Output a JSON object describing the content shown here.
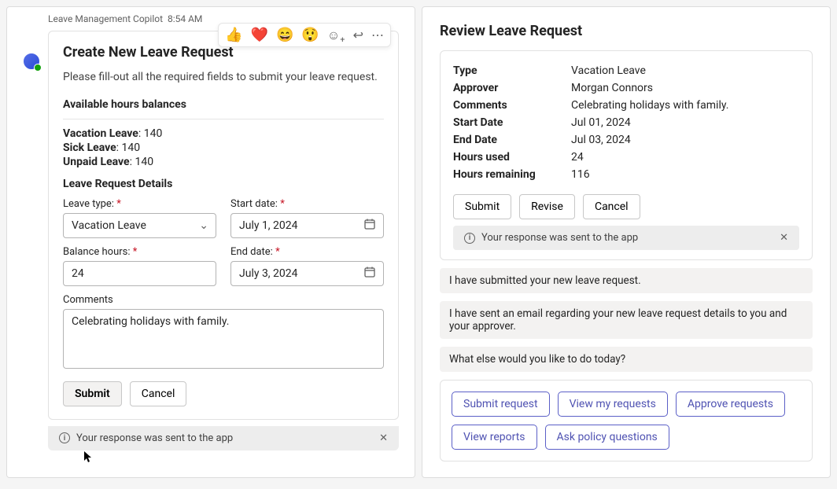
{
  "left": {
    "header": {
      "name": "Leave Management Copilot",
      "time": "8:54 AM"
    },
    "reactions": [
      "👍",
      "❤️",
      "😄",
      "😲"
    ],
    "card": {
      "title": "Create New Leave Request",
      "desc": "Please fill-out all the required fields to submit your leave request.",
      "balances_heading": "Available hours balances",
      "balances": [
        {
          "label": "Vacation Leave",
          "value": "140"
        },
        {
          "label": "Sick Leave",
          "value": "140"
        },
        {
          "label": "Unpaid Leave",
          "value": "140"
        }
      ],
      "details_heading": "Leave Request Details",
      "labels": {
        "leave_type": "Leave type:",
        "start_date": "Start date:",
        "balance_hours": "Balance hours:",
        "end_date": "End date:",
        "comments": "Comments"
      },
      "values": {
        "leave_type": "Vacation Leave",
        "start_date": "July 1, 2024",
        "balance_hours": "24",
        "end_date": "July 3, 2024",
        "comments": "Celebrating holidays with family."
      },
      "buttons": {
        "submit": "Submit",
        "cancel": "Cancel"
      },
      "status": "Your response was sent to the app"
    }
  },
  "right": {
    "title": "Review Leave Request",
    "rows": {
      "type_k": "Type",
      "type_v": "Vacation Leave",
      "approver_k": "Approver",
      "approver_v": "Morgan Connors",
      "comments_k": "Comments",
      "comments_v": "Celebrating holidays with family.",
      "start_k": "Start Date",
      "start_v": "Jul 01, 2024",
      "end_k": "End Date",
      "end_v": "Jul 03, 2024",
      "used_k": "Hours used",
      "used_v": "24",
      "remaining_k": "Hours remaining",
      "remaining_v": "116"
    },
    "buttons": {
      "submit": "Submit",
      "revise": "Revise",
      "cancel": "Cancel"
    },
    "status": "Your response was sent to the app",
    "messages": {
      "m1": "I have submitted your new leave request.",
      "m2": "I have sent an email regarding your new leave request details to you and your approver.",
      "m3": "What else would you like to do today?"
    },
    "chips": {
      "c1": "Submit request",
      "c2": "View my requests",
      "c3": "Approve requests",
      "c4": "View reports",
      "c5": "Ask policy questions"
    }
  }
}
